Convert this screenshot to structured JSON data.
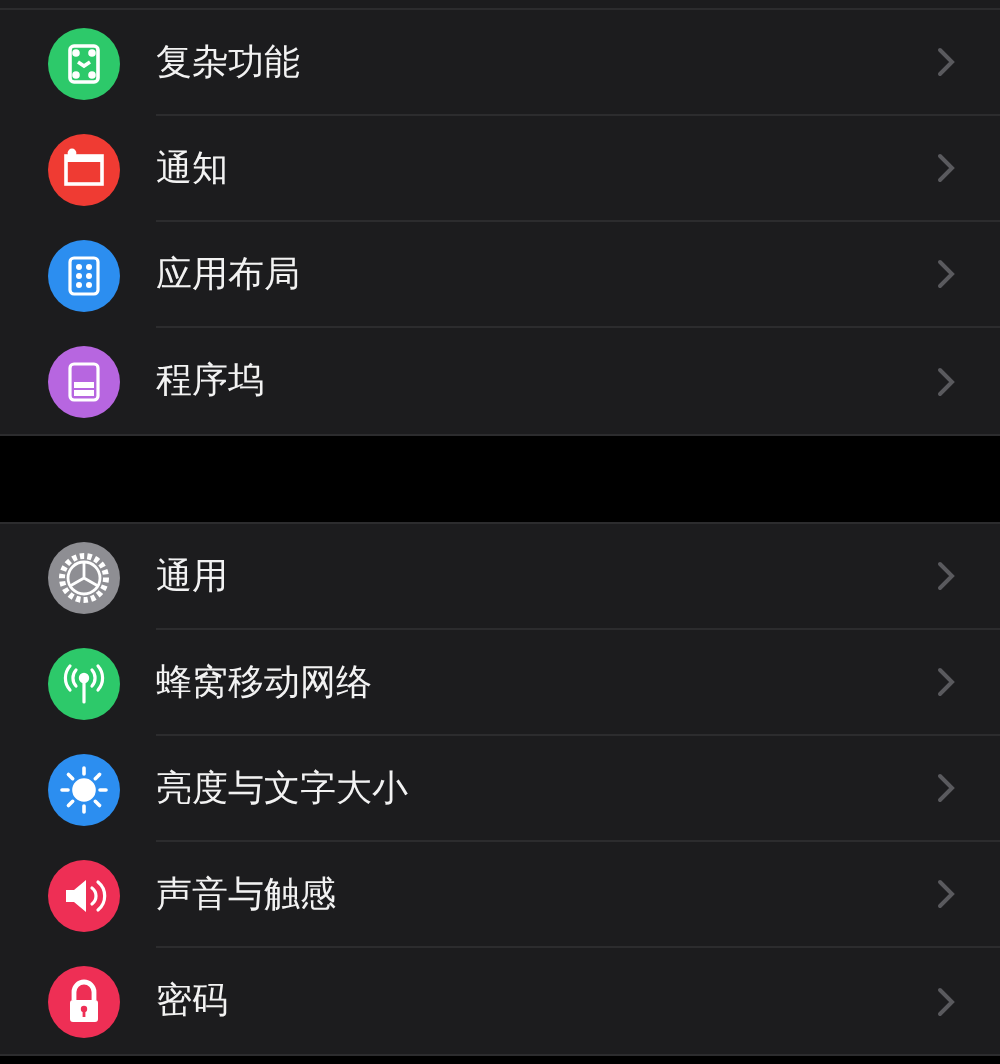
{
  "groups": [
    {
      "items": [
        {
          "label": "复杂功能",
          "kind": "complications",
          "color": "#2dc96a"
        },
        {
          "label": "通知",
          "kind": "notifications",
          "color": "#ef3b33"
        },
        {
          "label": "应用布局",
          "kind": "layout",
          "color": "#2c8ef0"
        },
        {
          "label": "程序坞",
          "kind": "dock",
          "color": "#b766e0"
        }
      ]
    },
    {
      "items": [
        {
          "label": "通用",
          "kind": "general",
          "color": "#8e8e93"
        },
        {
          "label": "蜂窝移动网络",
          "kind": "cellular",
          "color": "#2dc96a"
        },
        {
          "label": "亮度与文字大小",
          "kind": "brightness",
          "color": "#2c8ef0"
        },
        {
          "label": "声音与触感",
          "kind": "sound",
          "color": "#ee2f55"
        },
        {
          "label": "密码",
          "kind": "passcode",
          "color": "#ee2f55"
        }
      ]
    }
  ]
}
